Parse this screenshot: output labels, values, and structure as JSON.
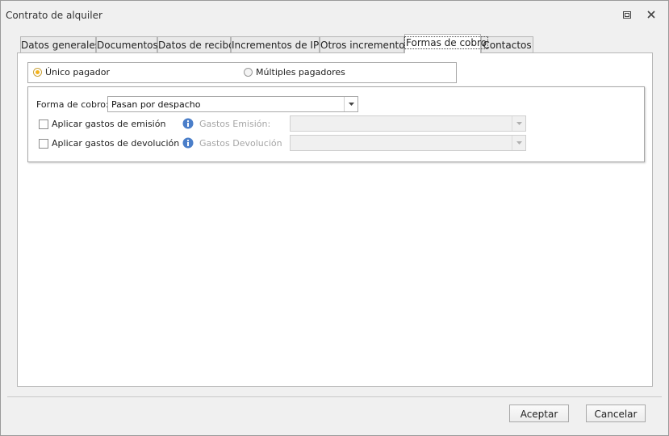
{
  "window": {
    "title": "Contrato de alquiler"
  },
  "tabs": [
    {
      "label": "Datos generales"
    },
    {
      "label": "Documentos"
    },
    {
      "label": "Datos de recibo"
    },
    {
      "label": "Incrementos de IPC"
    },
    {
      "label": "Otros incrementos"
    },
    {
      "label": "Formas de cobro"
    },
    {
      "label": "Contactos"
    }
  ],
  "active_tab": "Formas de cobro",
  "payer": {
    "single_label": "Único pagador",
    "multiple_label": "Múltiples pagadores",
    "selected": "Único pagador"
  },
  "payment": {
    "method_label": "Forma de cobro:",
    "method_value": "Pasan por despacho",
    "issue_fees_label": "Aplicar gastos de emisión",
    "issue_fees_field_label": "Gastos Emisión:",
    "return_fees_label": "Aplicar gastos de devolución",
    "return_fees_field_label": "Gastos Devolución"
  },
  "buttons": {
    "accept": "Aceptar",
    "cancel": "Cancelar"
  },
  "colors": {
    "radio_accent": "#f3b21b",
    "info_icon": "#4a7ec9"
  }
}
